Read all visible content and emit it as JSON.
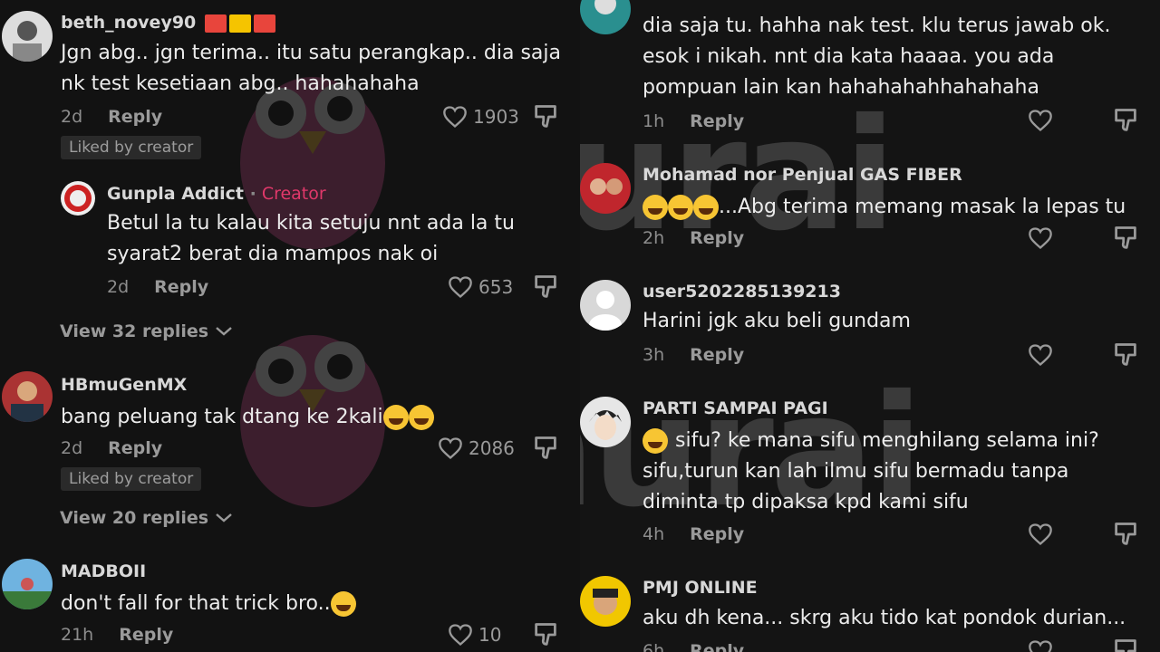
{
  "watermark": "murai",
  "left": {
    "comments": [
      {
        "user": "beth_novey90",
        "text": "Jgn abg.. jgn terima.. itu satu perangkap.. dia saja nk test kesetiaan abg.. hahahahaha",
        "time": "2d",
        "reply": "Reply",
        "likes": "1903",
        "badge": "Liked by creator"
      },
      {
        "user": "Gunpla Addict",
        "role": "Creator",
        "text": "Betul la tu kalau kita setuju nnt ada la tu syarat2 berat dia mampos nak oi",
        "time": "2d",
        "reply": "Reply",
        "likes": "653"
      },
      {
        "user": "HBmuGenMX",
        "text": "bang peluang tak dtang ke 2kali",
        "time": "2d",
        "reply": "Reply",
        "likes": "2086",
        "badge": "Liked by creator"
      },
      {
        "user": "MADBOII",
        "text": "don't fall for that trick bro..",
        "time": "21h",
        "reply": "Reply",
        "likes": "10"
      }
    ],
    "view_replies_1": "View 32 replies",
    "view_replies_2": "View 20 replies"
  },
  "right": {
    "comments": [
      {
        "user": "",
        "text": "dia saja tu. hahha nak test. klu terus jawab ok. esok i nikah. nnt dia kata haaaa. you ada pompuan lain kan hahahahahhahahaha",
        "time": "1h",
        "reply": "Reply"
      },
      {
        "user": "Mohamad nor Penjual GAS FIBER",
        "text": "...Abg terima memang masak la lepas tu",
        "time": "2h",
        "reply": "Reply"
      },
      {
        "user": "user5202285139213",
        "text": "Harini jgk aku beli gundam",
        "time": "3h",
        "reply": "Reply"
      },
      {
        "user": "PARTI SAMPAI PAGI",
        "text": "sifu? ke mana sifu menghilang selama ini? sifu,turun kan lah ilmu sifu bermadu tanpa diminta tp dipaksa kpd kami sifu",
        "time": "4h",
        "reply": "Reply"
      },
      {
        "user": "PMJ ONLINE",
        "text": "aku dh kena... skrg aku tido kat pondok durian...",
        "time": "6h",
        "reply": "Reply"
      }
    ]
  },
  "colors": {
    "creator": "#e0386a",
    "background": "#121212"
  }
}
